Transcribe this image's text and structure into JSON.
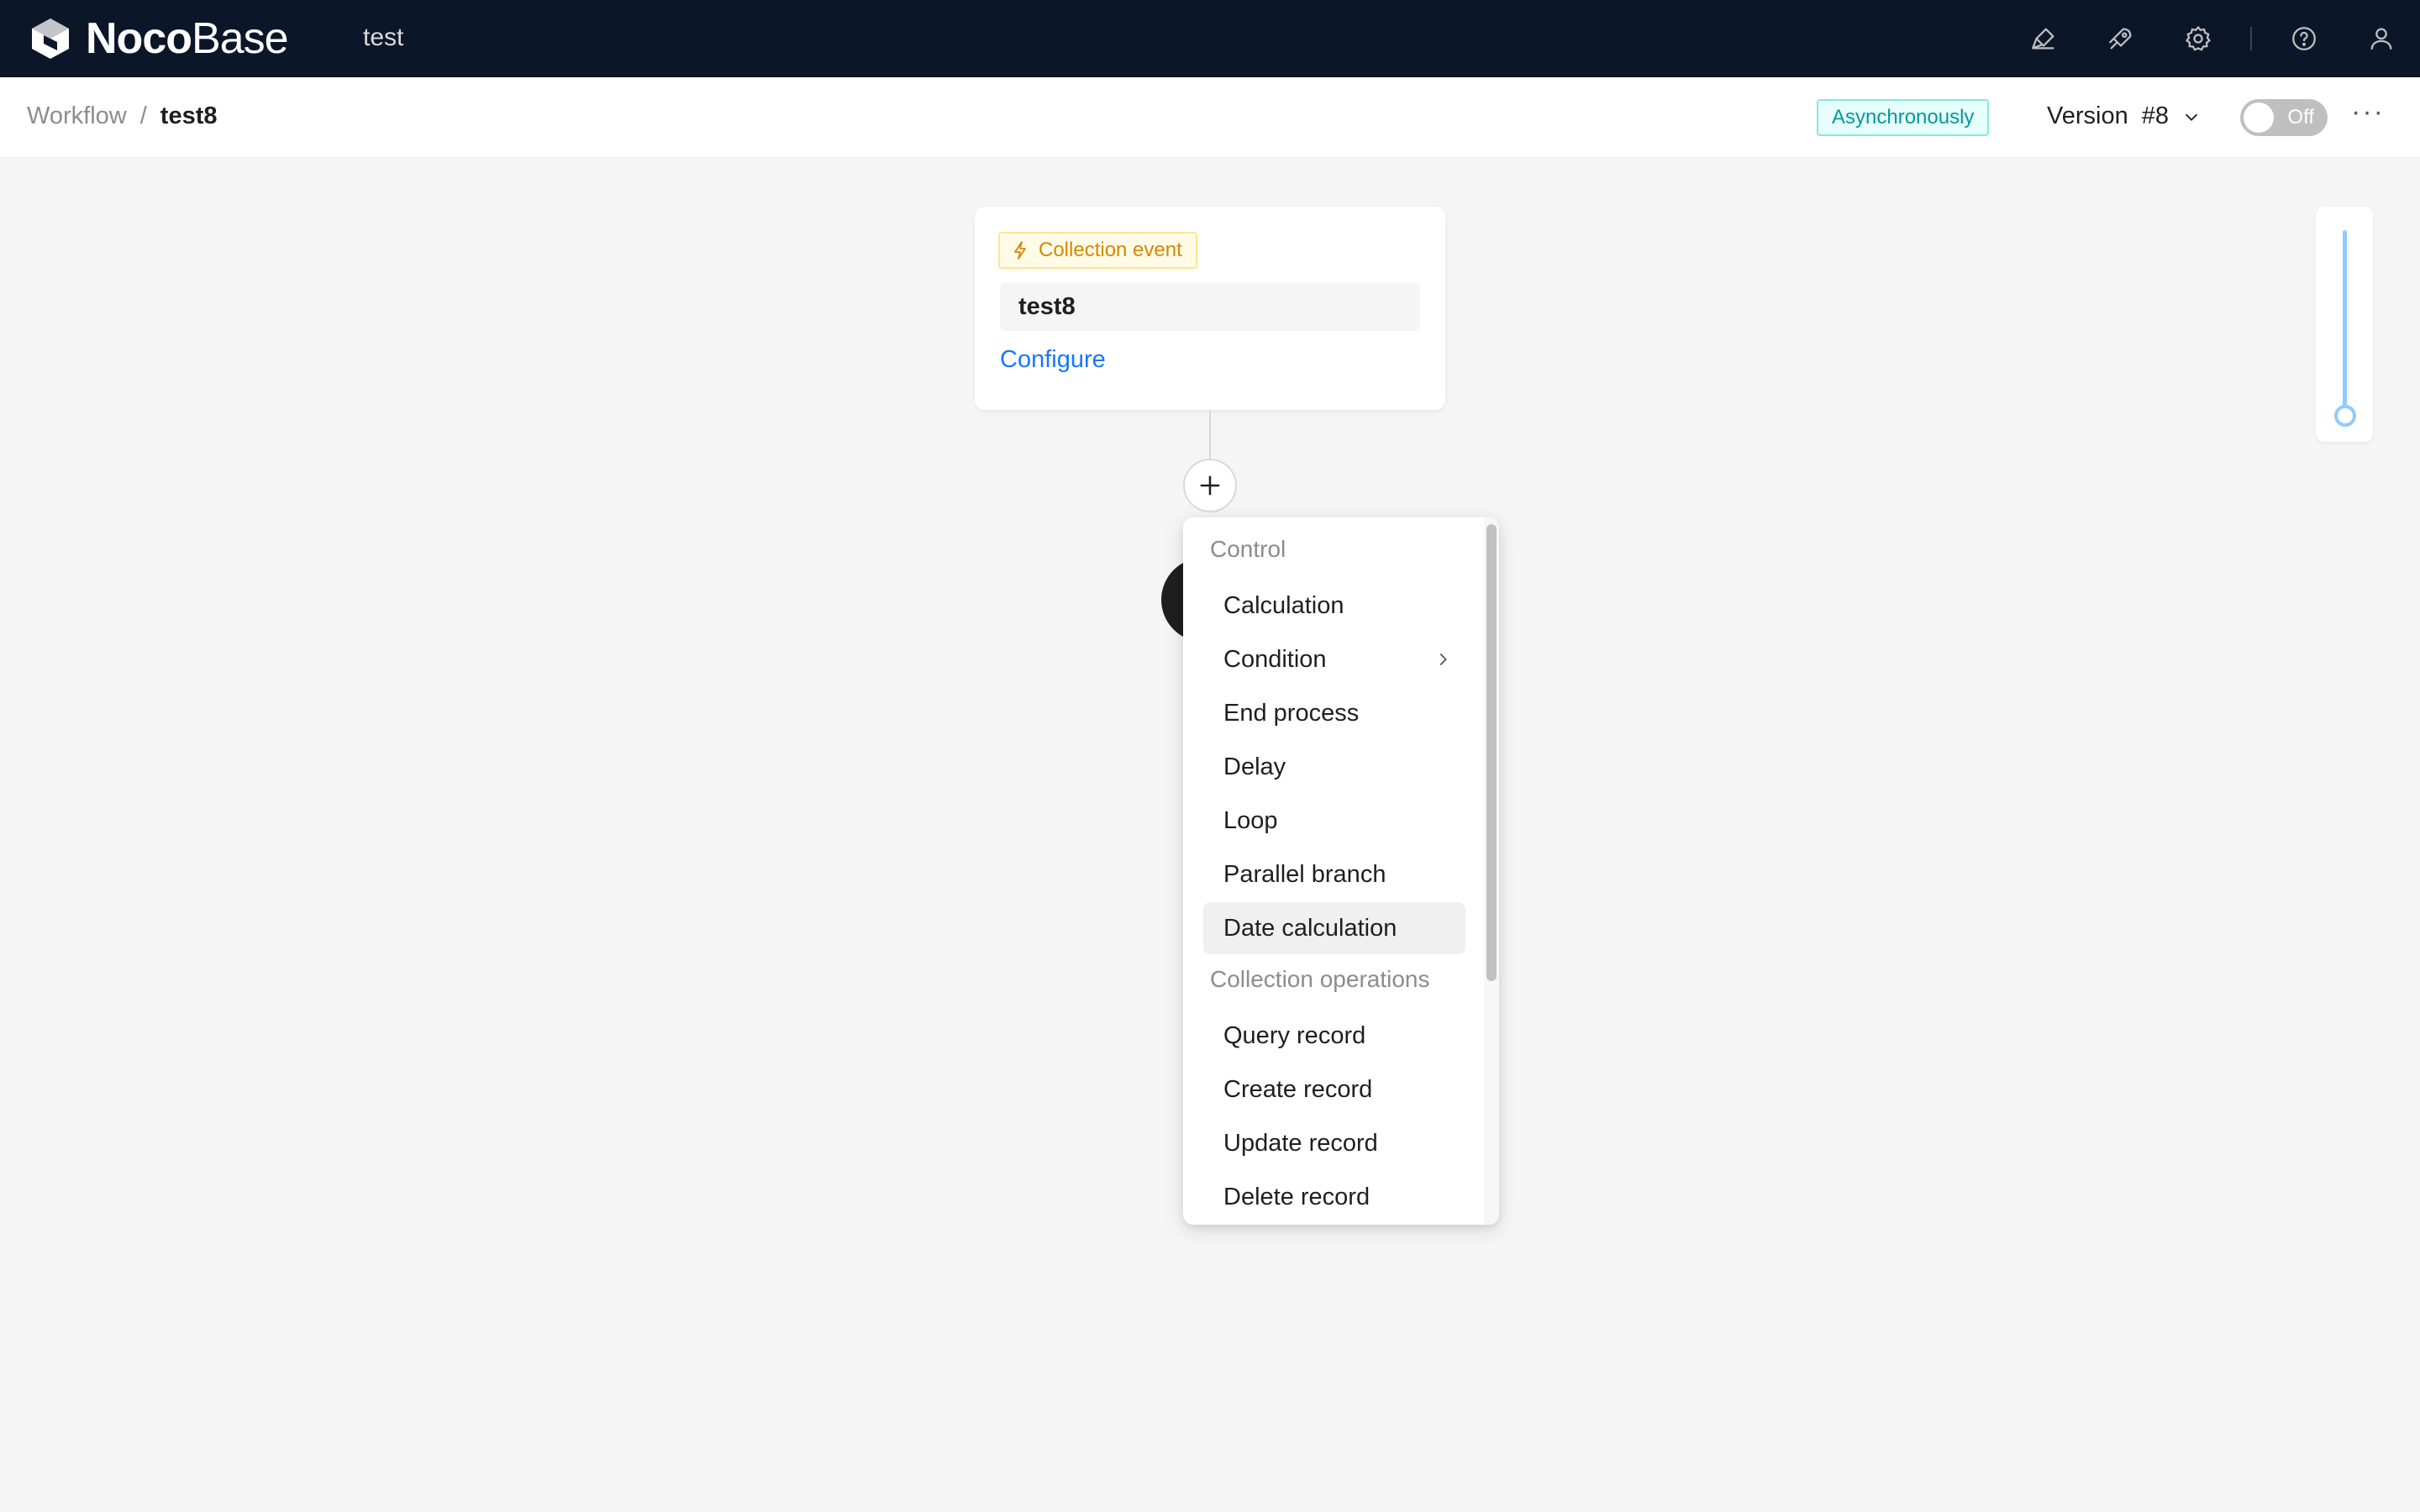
{
  "topbar": {
    "logo_bold": "Noco",
    "logo_light": "Base",
    "app_name": "test",
    "icons": [
      "theme-brush-icon",
      "plugin-rocket-icon",
      "settings-gear-icon",
      "help-question-icon",
      "user-icon"
    ]
  },
  "header": {
    "breadcrumb": {
      "root": "Workflow",
      "separator": "/",
      "current": "test8"
    },
    "mode_tag": "Asynchronously",
    "version_label": "Version",
    "version_number": "#8",
    "toggle_label": "Off",
    "more_label": "···"
  },
  "trigger": {
    "type_label": "Collection event",
    "title": "test8",
    "configure_label": "Configure"
  },
  "add_menu": {
    "groups": [
      {
        "title": "Control",
        "items": [
          "Calculation",
          "Condition",
          "End process",
          "Delay",
          "Loop",
          "Parallel branch",
          "Date calculation"
        ]
      },
      {
        "title": "Collection operations",
        "items": [
          "Query record",
          "Create record",
          "Update record",
          "Delete record"
        ]
      }
    ],
    "highlighted_item": "Date calculation",
    "submenu_item": "Condition"
  },
  "zoom": {
    "level": 1.0
  },
  "colors": {
    "topbar_bg": "#0c1629",
    "canvas_bg": "#f5f5f5",
    "link": "#1677ff",
    "async_tag": "#08979c",
    "trigger_tag": "#d48806"
  }
}
